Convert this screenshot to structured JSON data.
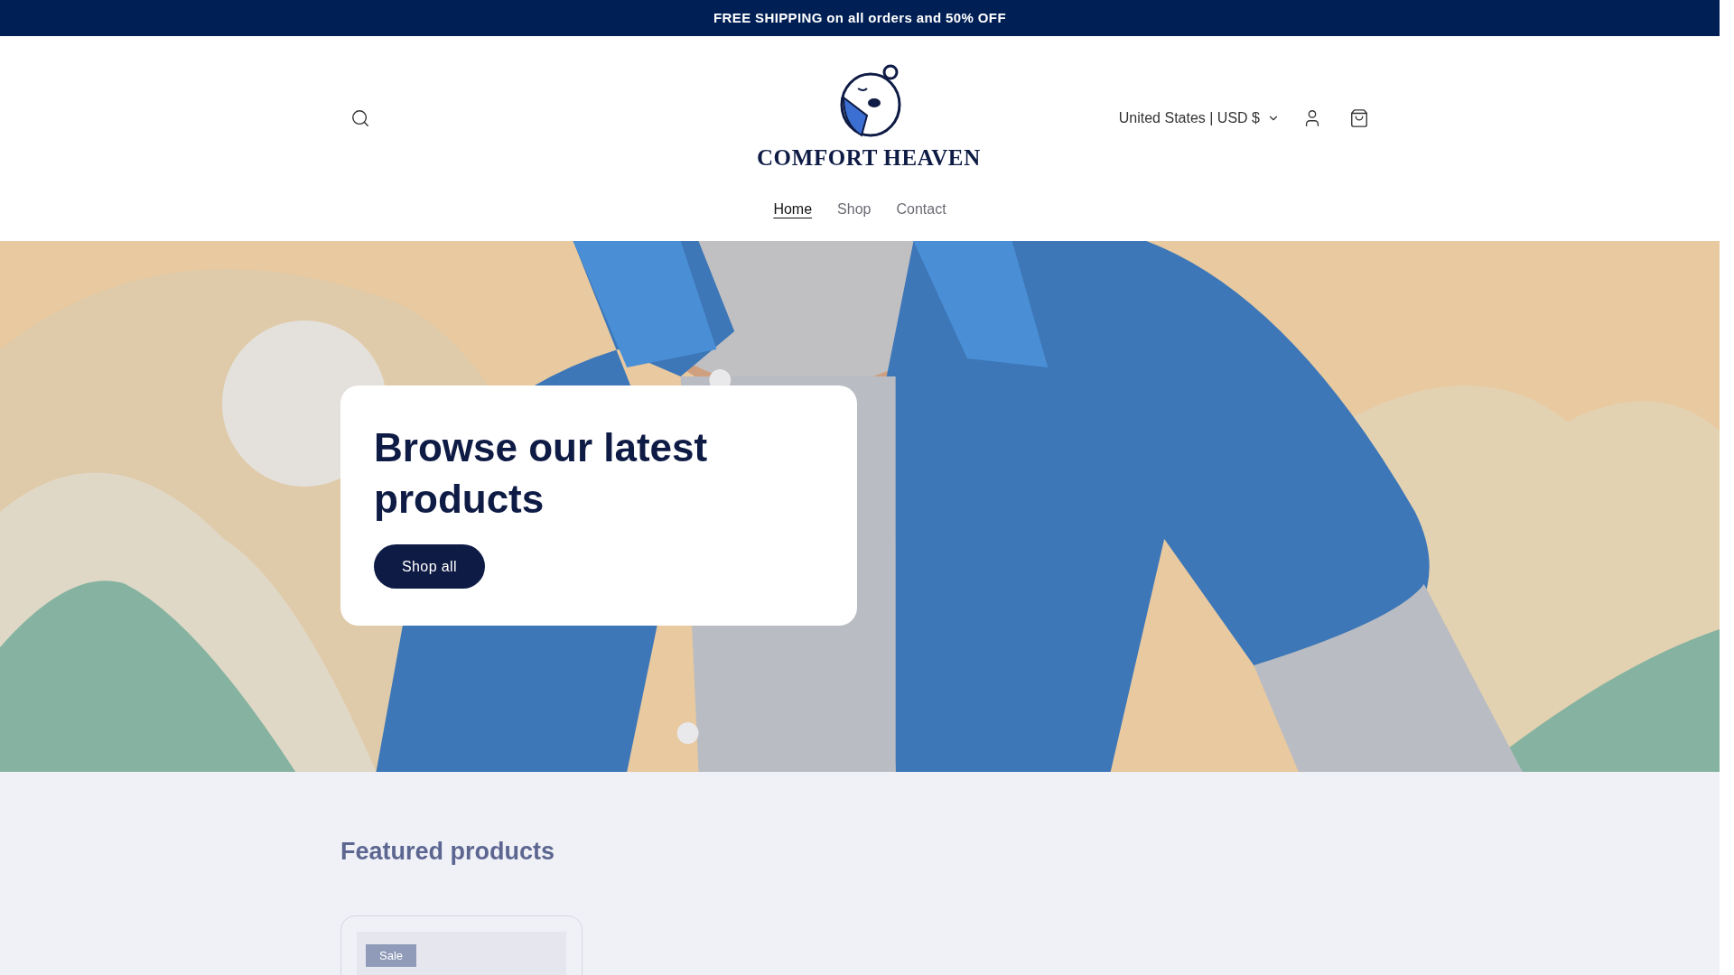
{
  "announcement": "FREE SHIPPING on all orders and 50% OFF",
  "header": {
    "brand": "COMFORT HEAVEN",
    "country": "United States | USD $"
  },
  "nav": [
    {
      "label": "Home",
      "selected": true
    },
    {
      "label": "Shop",
      "selected": false
    },
    {
      "label": "Contact",
      "selected": false
    }
  ],
  "hero": {
    "heading": "Browse our latest products",
    "button": "Shop all"
  },
  "featured": {
    "heading": "Featured products",
    "products": [
      {
        "badge": "Sale"
      }
    ]
  }
}
